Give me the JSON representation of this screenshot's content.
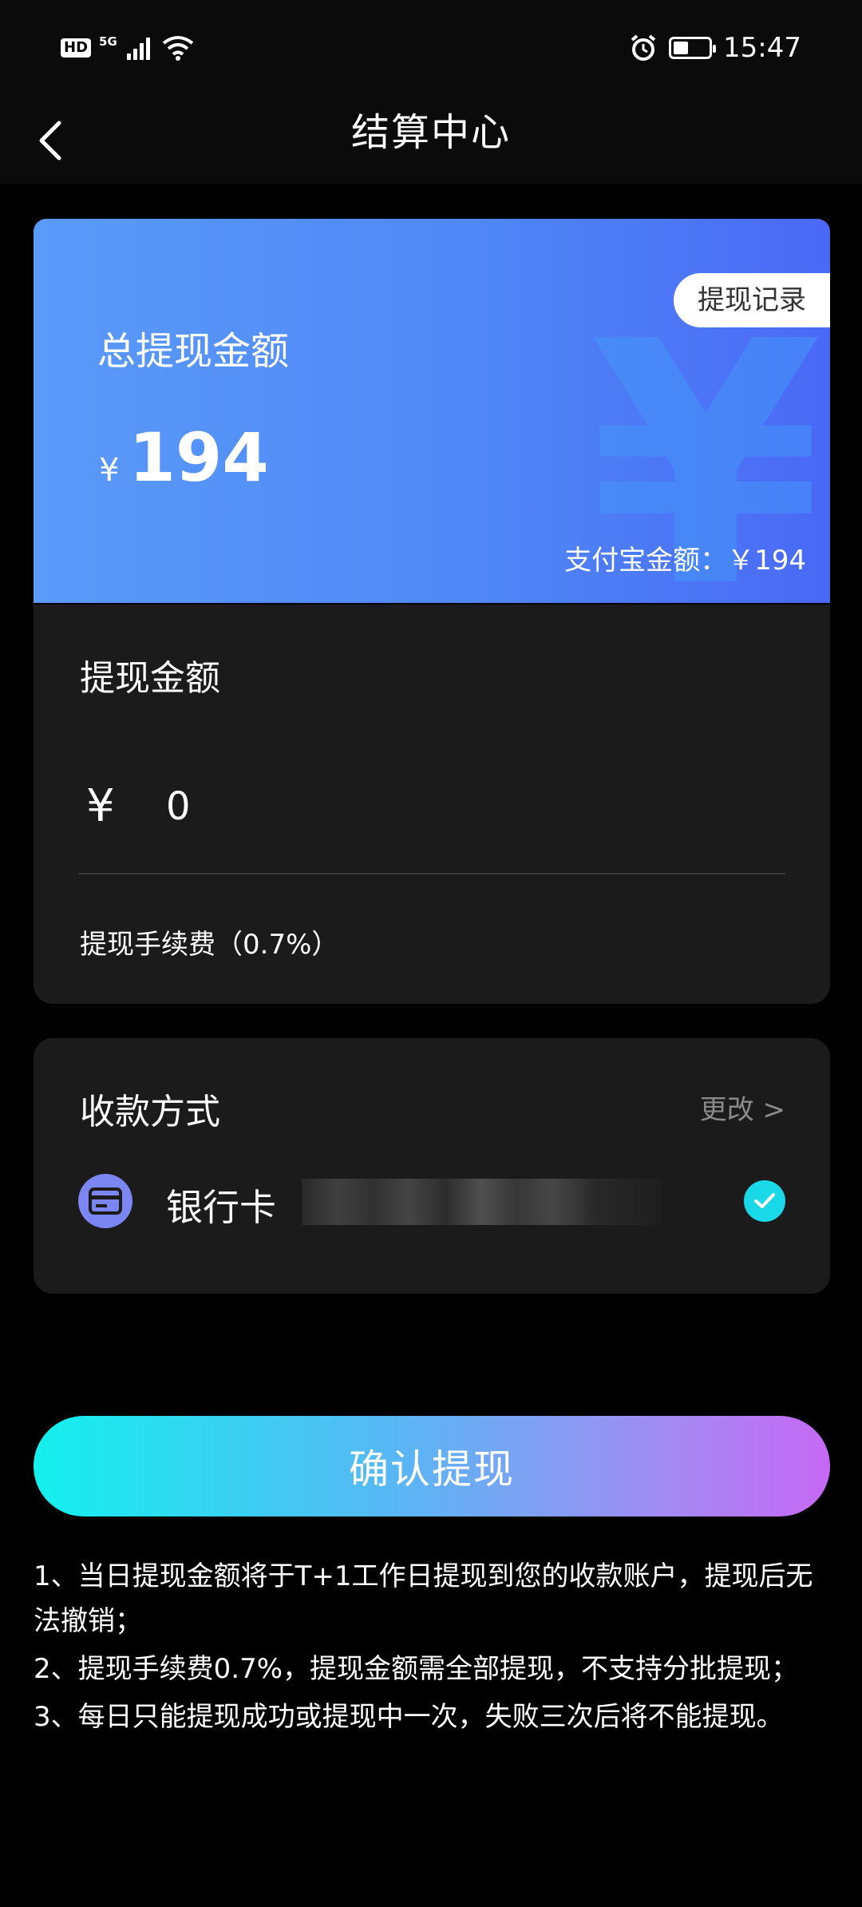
{
  "status_bar": {
    "left_hd": "HD",
    "left_network": "5G",
    "time": "15:47"
  },
  "header": {
    "title": "结算中心"
  },
  "balance_card": {
    "record_button": "提现记录",
    "total_label": "总提现金额",
    "currency": "¥",
    "total_amount": "194",
    "alipay_balance": "支付宝金额：￥194"
  },
  "withdraw": {
    "title": "提现金额",
    "currency": "¥",
    "amount_value": "0",
    "fee_text": "提现手续费（0.7%）"
  },
  "payment_method": {
    "title": "收款方式",
    "change_label": "更改 >",
    "bank_label": "银行卡"
  },
  "confirm_button": "确认提现",
  "notes": [
    "1、当日提现金额将于T+1工作日提现到您的收款账户，提现后无法撤销；",
    "2、提现手续费0.7%，提现金额需全部提现，不支持分批提现；",
    "3、每日只能提现成功或提现中一次，失败三次后将不能提现。"
  ],
  "colors": {
    "accent_cyan": "#19d9e8",
    "card_blue": "#4f88f7",
    "button_start": "#14f0ee",
    "button_end": "#c668f4"
  }
}
